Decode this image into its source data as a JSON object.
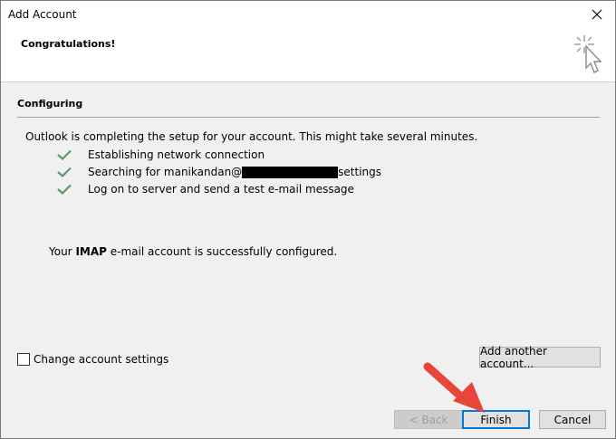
{
  "window": {
    "title": "Add Account"
  },
  "header": {
    "title": "Congratulations!",
    "icon": "cursor-sparkle-icon"
  },
  "section": {
    "title": "Configuring"
  },
  "intro": "Outlook is completing the setup for your account. This might take several minutes.",
  "steps": [
    {
      "label": "Establishing network connection",
      "status": "done"
    },
    {
      "label_before": "Searching for manikandan@",
      "label_after": "settings",
      "status": "done"
    },
    {
      "label": "Log on to server and send a test e-mail message",
      "status": "done"
    }
  ],
  "success": {
    "prefix": "Your ",
    "protocol": "IMAP",
    "suffix": " e-mail account is successfully configured."
  },
  "change_settings": {
    "label": "Change account settings",
    "checked": false
  },
  "buttons": {
    "add_another": "Add another account...",
    "back": "< Back",
    "finish": "Finish",
    "cancel": "Cancel"
  },
  "colors": {
    "check": "#5a9a6e",
    "accent": "#0078d7",
    "annotation_arrow": "#e8463b"
  }
}
